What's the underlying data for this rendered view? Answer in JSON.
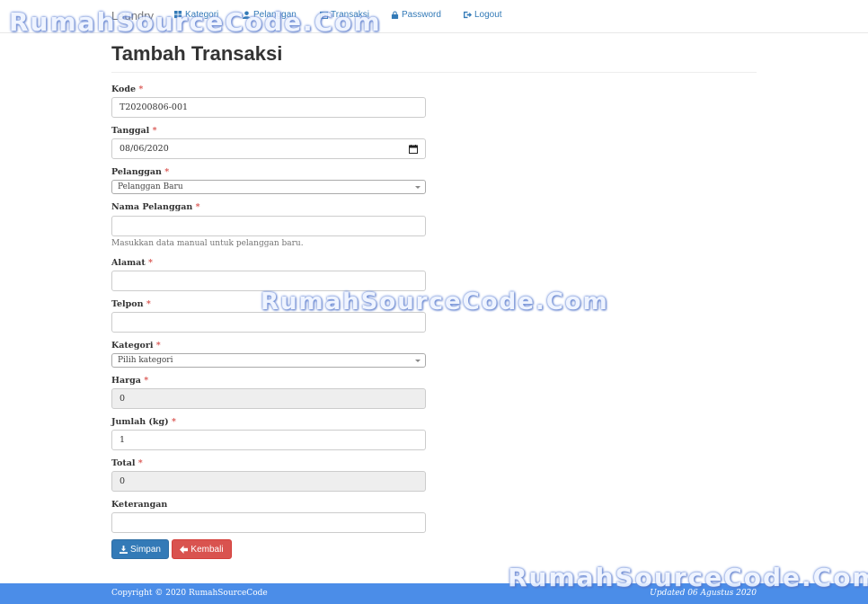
{
  "nav": {
    "brand": "Laundry",
    "items": [
      {
        "label": "Kategori",
        "icon": "grid-icon"
      },
      {
        "label": "Pelanggan",
        "icon": "user-icon"
      },
      {
        "label": "Transaksi",
        "icon": "calendar-icon"
      },
      {
        "label": "Password",
        "icon": "lock-icon"
      },
      {
        "label": "Logout",
        "icon": "logout-icon"
      }
    ]
  },
  "watermark": "RumahSourceCode.Com",
  "page_title": "Tambah Transaksi",
  "required_mark": "*",
  "form": {
    "kode": {
      "label": "Kode",
      "value": "T20200806-001"
    },
    "tanggal": {
      "label": "Tanggal",
      "value": "08/06/2020"
    },
    "pelanggan": {
      "label": "Pelanggan",
      "selected": "Pelanggan Baru"
    },
    "nama_pelanggan": {
      "label": "Nama Pelanggan",
      "value": "",
      "help": "Masukkan data manual untuk pelanggan baru."
    },
    "alamat": {
      "label": "Alamat",
      "value": ""
    },
    "telpon": {
      "label": "Telpon",
      "value": ""
    },
    "kategori": {
      "label": "Kategori",
      "selected": "Pilih kategori"
    },
    "harga": {
      "label": "Harga",
      "value": "0"
    },
    "jumlah": {
      "label": "Jumlah (kg)",
      "value": "1"
    },
    "total": {
      "label": "Total",
      "value": "0"
    },
    "keterangan": {
      "label": "Keterangan",
      "value": ""
    }
  },
  "buttons": {
    "save": "Simpan",
    "back": "Kembali"
  },
  "footer": {
    "left": "Copyright © 2020 RumahSourceCode",
    "right": "Updated 06 Agustus 2020"
  },
  "colors": {
    "primary": "#337ab7",
    "danger": "#d9534f",
    "footer": "#4b8de8",
    "required": "#d9534f"
  }
}
